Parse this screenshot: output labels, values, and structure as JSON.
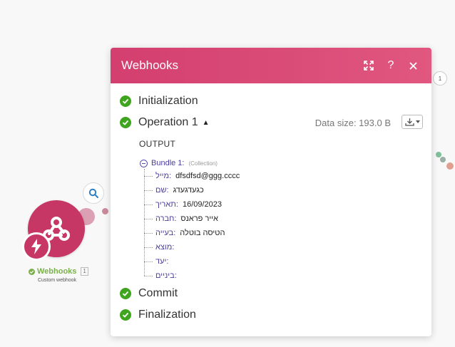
{
  "dialog": {
    "title": "Webhooks",
    "steps": {
      "initialization": "Initialization",
      "operation": "Operation 1",
      "commit": "Commit",
      "finalization": "Finalization"
    },
    "data_size": "Data size: 193.0 B",
    "output_label": "OUTPUT",
    "bundle": {
      "title": "Bundle 1:",
      "type": "(Collection)",
      "rows": [
        {
          "key": "מייל:",
          "value": "dfsdfsd@ggg.cccc"
        },
        {
          "key": "שם:",
          "value": "כגעדגעדג"
        },
        {
          "key": "תאריך:",
          "value": "16/09/2023"
        },
        {
          "key": "חברה:",
          "value": "אייר פראנס"
        },
        {
          "key": "בעייה:",
          "value": "הטיסה בוטלה"
        },
        {
          "key": "מוצא:",
          "value": ""
        },
        {
          "key": "יעד:",
          "value": ""
        },
        {
          "key": "ביניים:",
          "value": ""
        }
      ]
    },
    "icons": {
      "expand": "expand-icon",
      "help": "help-icon",
      "close": "close-icon",
      "download": "download-icon"
    }
  },
  "canvas": {
    "module_label": "Webhooks",
    "module_count": "1",
    "module_subtitle": "Custom webhook",
    "side_node_count": "1"
  },
  "colors": {
    "header": "#d33f70",
    "success": "#40a51e",
    "module": "#c63766",
    "key_text": "#4b3f9e"
  }
}
